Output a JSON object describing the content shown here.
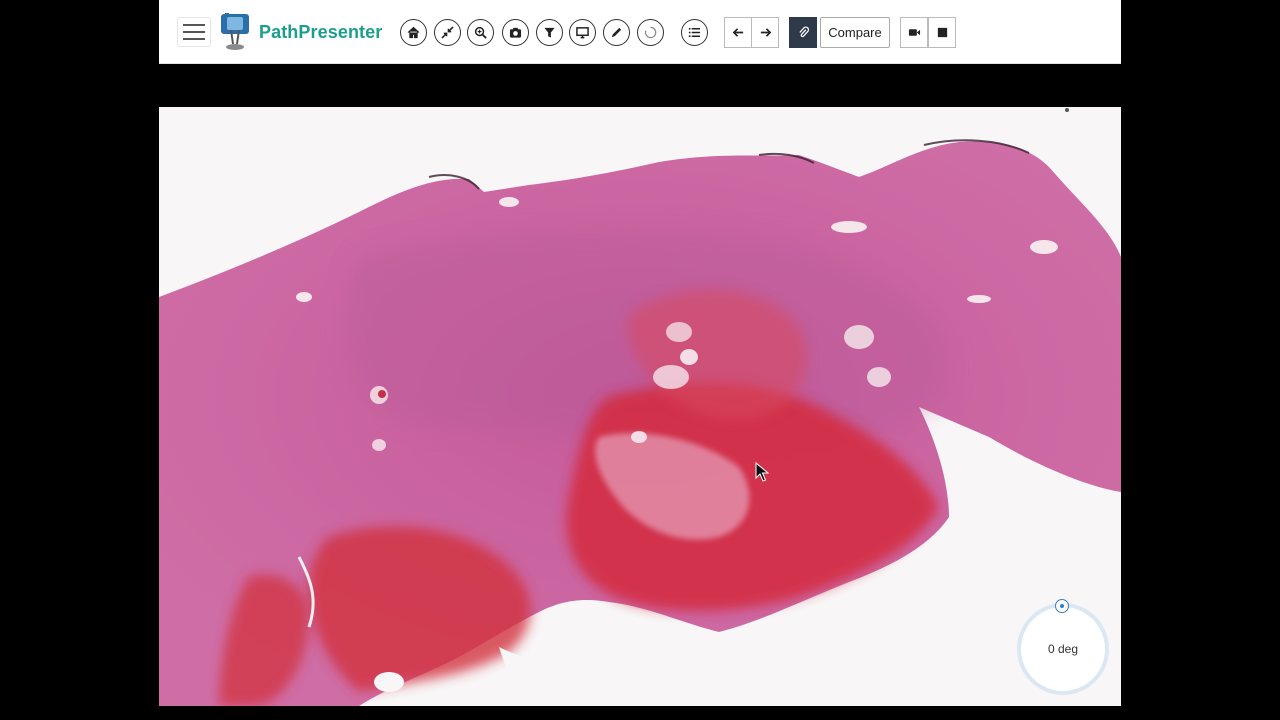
{
  "app": {
    "name": "PathPresenter"
  },
  "toolbar": {
    "menu_icon": "hamburger-icon",
    "tools": [
      {
        "name": "home-button",
        "icon": "home-icon"
      },
      {
        "name": "fullscreen-button",
        "icon": "collapse-arrows-icon"
      },
      {
        "name": "zoom-button",
        "icon": "magnifier-icon"
      },
      {
        "name": "snapshot-button",
        "icon": "camera-icon"
      },
      {
        "name": "filter-button",
        "icon": "funnel-icon"
      },
      {
        "name": "present-button",
        "icon": "monitor-icon"
      },
      {
        "name": "annotate-button",
        "icon": "pencil-icon"
      },
      {
        "name": "rotate-button",
        "icon": "lasso-icon"
      },
      {
        "name": "list-button",
        "icon": "list-icon"
      }
    ],
    "nav": [
      {
        "name": "prev-slide-button",
        "icon": "arrow-left-icon"
      },
      {
        "name": "next-slide-button",
        "icon": "arrow-right-icon"
      }
    ],
    "attach_icon": "paperclip-icon",
    "compare_label": "Compare",
    "record_icon": "video-camera-icon",
    "stop_icon": "stop-square-icon"
  },
  "viewer": {
    "rotation_label": "0 deg",
    "colors": {
      "tissue": "#c9609a",
      "hemorrhage": "#d8303f",
      "background": "#f7f5f6"
    }
  }
}
